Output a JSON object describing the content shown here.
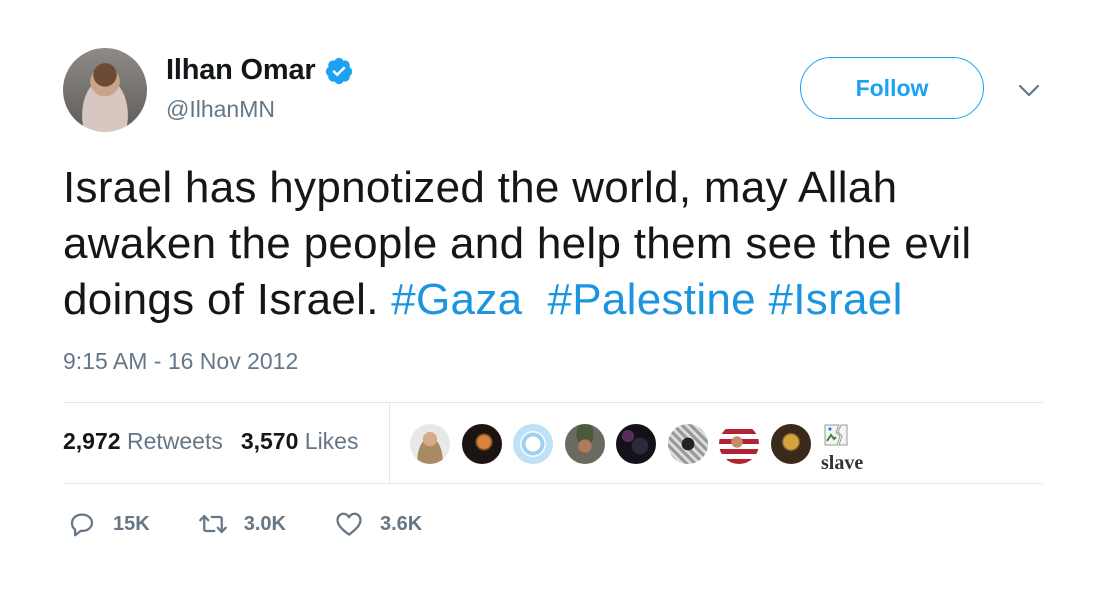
{
  "author": {
    "name": "Ilhan Omar",
    "handle": "@IlhanMN",
    "verified": true
  },
  "follow_label": "Follow",
  "tweet": {
    "text": "Israel has hypnotized the world, may Allah awaken the people and help them see the evil doings of Israel.",
    "hashtags": [
      "#Gaza",
      "#Palestine",
      "#Israel"
    ],
    "timestamp": "9:15 AM - 16 Nov 2012"
  },
  "stats": {
    "retweets_count": "2,972",
    "retweets_label": "Retweets",
    "likes_count": "3,570",
    "likes_label": "Likes"
  },
  "likers": {
    "broken_image_alt": "slave"
  },
  "actions": {
    "replies": "15K",
    "retweets": "3.0K",
    "likes": "3.6K"
  },
  "colors": {
    "accent": "#1da1f2",
    "hashtag": "#1b95e0",
    "muted": "#657786",
    "divider": "#e1e8ed"
  }
}
